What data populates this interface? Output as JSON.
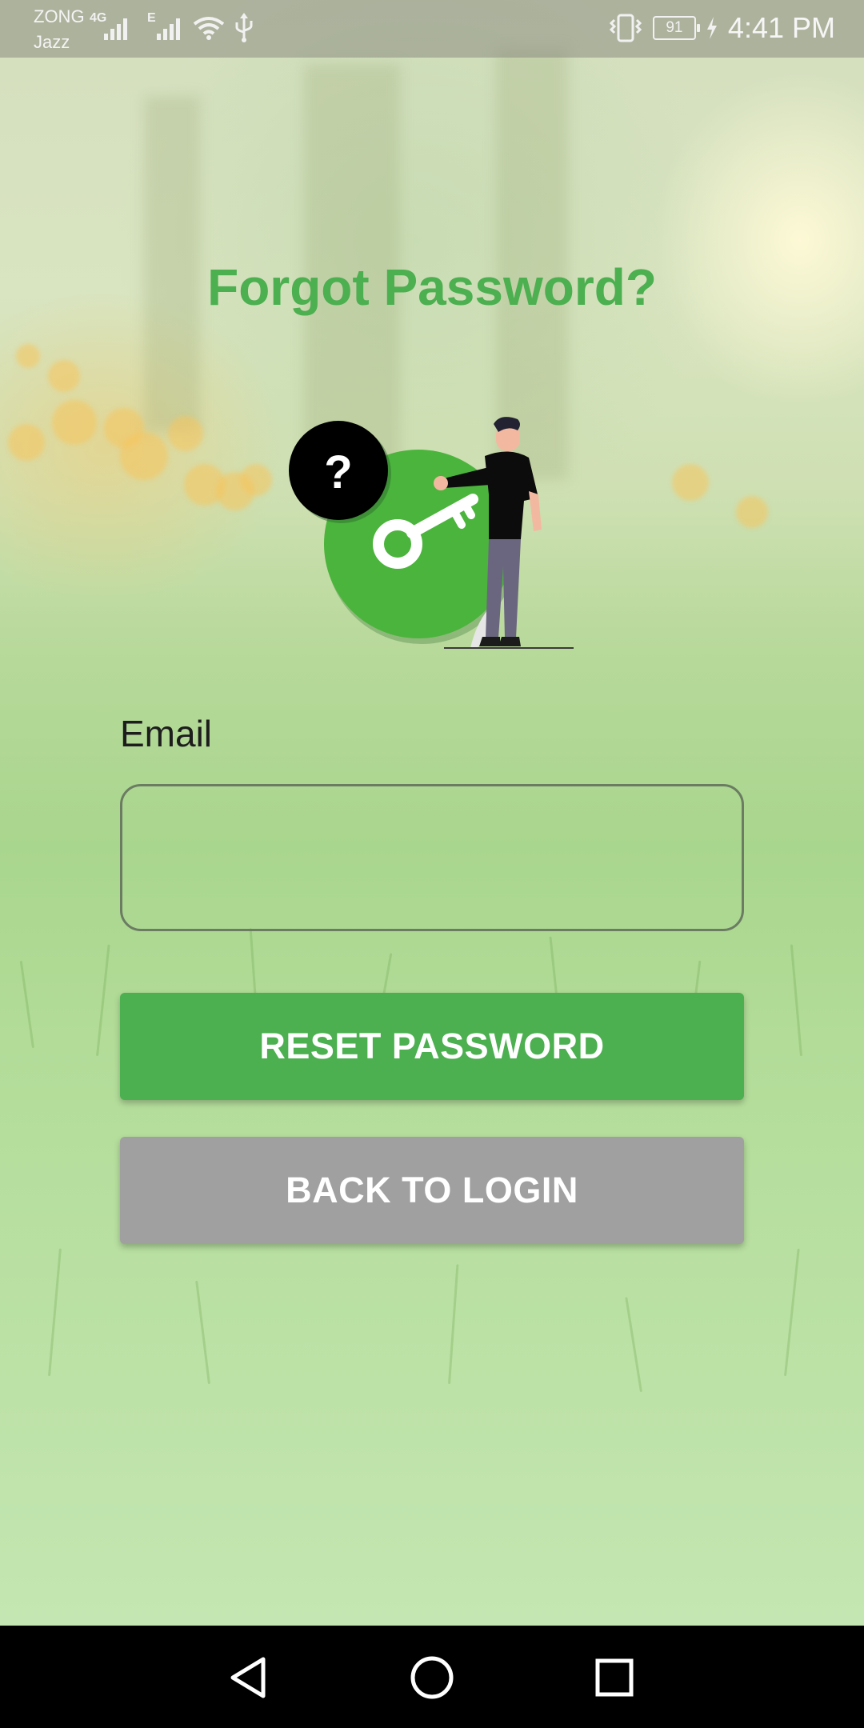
{
  "status_bar": {
    "carrier_primary": "ZONG",
    "carrier_secondary": "Jazz",
    "network_type_1": "4G",
    "network_type_2": "E",
    "battery_level": "91",
    "time": "4:41 PM",
    "icons": [
      "signal-icon",
      "wifi-icon",
      "usb-icon",
      "vibrate-icon",
      "battery-icon",
      "charging-icon"
    ]
  },
  "page": {
    "title": "Forgot Password?",
    "illustration": "forgot-password-illustration"
  },
  "form": {
    "email_label": "Email",
    "email_value": "",
    "email_placeholder": ""
  },
  "buttons": {
    "reset_label": "RESET PASSWORD",
    "back_label": "BACK TO LOGIN"
  },
  "nav_bar": {
    "items": [
      "back-icon",
      "home-icon",
      "recents-icon"
    ]
  },
  "colors": {
    "accent": "#4caf50",
    "secondary_button": "#a0a0a0",
    "label_text": "#1d1d1d"
  }
}
